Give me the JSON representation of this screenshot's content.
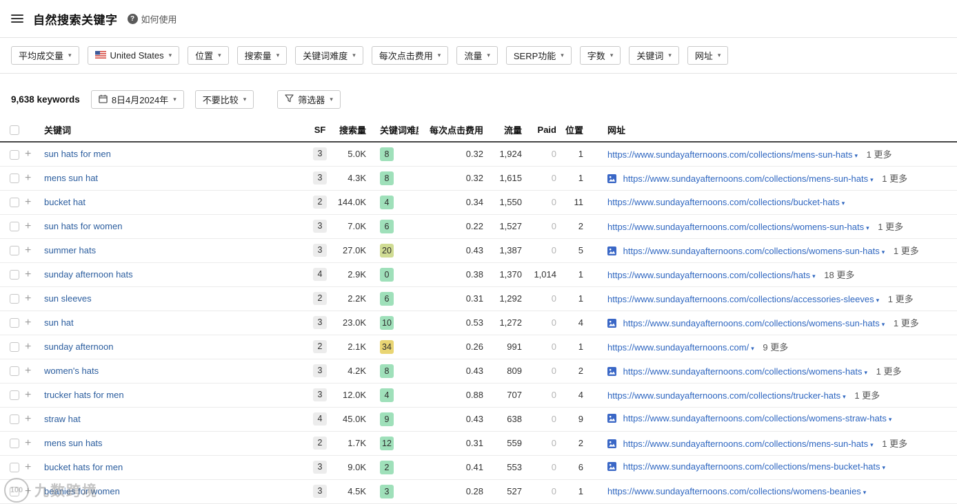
{
  "topbar": {
    "title": "自然搜索关键字",
    "help_label": "如何使用"
  },
  "filterbar": {
    "buttons": [
      {
        "label": "平均成交量",
        "icon": ""
      },
      {
        "label": "United States",
        "icon": "us-flag"
      },
      {
        "label": "位置",
        "icon": ""
      },
      {
        "label": "搜索量",
        "icon": ""
      },
      {
        "label": "关键词难度",
        "icon": ""
      },
      {
        "label": "每次点击费用",
        "icon": ""
      },
      {
        "label": "流量",
        "icon": ""
      },
      {
        "label": "SERP功能",
        "icon": ""
      },
      {
        "label": "字数",
        "icon": ""
      },
      {
        "label": "关键词",
        "icon": ""
      },
      {
        "label": "网址",
        "icon": ""
      }
    ]
  },
  "toolbar": {
    "count": "9,638 keywords",
    "date_label": "8日4月2024年",
    "compare_label": "不要比较",
    "filter_label": "筛选器"
  },
  "table": {
    "headers": {
      "keyword": "关键词",
      "sf": "SF",
      "volume": "搜索量",
      "kd": "关键词难度",
      "cpc": "每次点击费用",
      "traffic": "流量",
      "paid": "Paid",
      "position": "位置",
      "url": "网址"
    },
    "rows": [
      {
        "keyword": "sun hats for men",
        "sf": "3",
        "volume": "5.0K",
        "kd": "8",
        "kd_level": "easy",
        "cpc": "0.32",
        "traffic": "1,924",
        "paid": "0",
        "paid_muted": true,
        "position": "1",
        "thumb": false,
        "url": "https://www.sundayafternoons.com/collections/mens-sun-hats",
        "more": "1 更多"
      },
      {
        "keyword": "mens sun hat",
        "sf": "3",
        "volume": "4.3K",
        "kd": "8",
        "kd_level": "easy",
        "cpc": "0.32",
        "traffic": "1,615",
        "paid": "0",
        "paid_muted": true,
        "position": "1",
        "thumb": true,
        "url": "https://www.sundayafternoons.com/collections/mens-sun-hats",
        "more": "1 更多"
      },
      {
        "keyword": "bucket hat",
        "sf": "2",
        "volume": "144.0K",
        "kd": "4",
        "kd_level": "easy",
        "cpc": "0.34",
        "traffic": "1,550",
        "paid": "0",
        "paid_muted": true,
        "position": "11",
        "thumb": false,
        "url": "https://www.sundayafternoons.com/collections/bucket-hats",
        "more": ""
      },
      {
        "keyword": "sun hats for women",
        "sf": "3",
        "volume": "7.0K",
        "kd": "6",
        "kd_level": "easy",
        "cpc": "0.22",
        "traffic": "1,527",
        "paid": "0",
        "paid_muted": true,
        "position": "2",
        "thumb": false,
        "url": "https://www.sundayafternoons.com/collections/womens-sun-hats",
        "more": "1 更多"
      },
      {
        "keyword": "summer hats",
        "sf": "3",
        "volume": "27.0K",
        "kd": "20",
        "kd_level": "medium",
        "cpc": "0.43",
        "traffic": "1,387",
        "paid": "0",
        "paid_muted": true,
        "position": "5",
        "thumb": true,
        "url": "https://www.sundayafternoons.com/collections/womens-sun-hats",
        "more": "1 更多"
      },
      {
        "keyword": "sunday afternoon hats",
        "sf": "4",
        "volume": "2.9K",
        "kd": "0",
        "kd_level": "easy",
        "cpc": "0.38",
        "traffic": "1,370",
        "paid": "1,014",
        "paid_muted": false,
        "position": "1",
        "thumb": false,
        "url": "https://www.sundayafternoons.com/collections/hats",
        "more": "18 更多"
      },
      {
        "keyword": "sun sleeves",
        "sf": "2",
        "volume": "2.2K",
        "kd": "6",
        "kd_level": "easy",
        "cpc": "0.31",
        "traffic": "1,292",
        "paid": "0",
        "paid_muted": true,
        "position": "1",
        "thumb": false,
        "url": "https://www.sundayafternoons.com/collections/accessories-sleeves",
        "more": "1 更多"
      },
      {
        "keyword": "sun hat",
        "sf": "3",
        "volume": "23.0K",
        "kd": "10",
        "kd_level": "easy",
        "cpc": "0.53",
        "traffic": "1,272",
        "paid": "0",
        "paid_muted": true,
        "position": "4",
        "thumb": true,
        "url": "https://www.sundayafternoons.com/collections/womens-sun-hats",
        "more": "1 更多"
      },
      {
        "keyword": "sunday afternoon",
        "sf": "2",
        "volume": "2.1K",
        "kd": "34",
        "kd_level": "hard",
        "cpc": "0.26",
        "traffic": "991",
        "paid": "0",
        "paid_muted": true,
        "position": "1",
        "thumb": false,
        "url": "https://www.sundayafternoons.com/",
        "more": "9 更多"
      },
      {
        "keyword": "women's hats",
        "sf": "3",
        "volume": "4.2K",
        "kd": "8",
        "kd_level": "easy",
        "cpc": "0.43",
        "traffic": "809",
        "paid": "0",
        "paid_muted": true,
        "position": "2",
        "thumb": true,
        "url": "https://www.sundayafternoons.com/collections/womens-hats",
        "more": "1 更多"
      },
      {
        "keyword": "trucker hats for men",
        "sf": "3",
        "volume": "12.0K",
        "kd": "4",
        "kd_level": "easy",
        "cpc": "0.88",
        "traffic": "707",
        "paid": "0",
        "paid_muted": true,
        "position": "4",
        "thumb": false,
        "url": "https://www.sundayafternoons.com/collections/trucker-hats",
        "more": "1 更多"
      },
      {
        "keyword": "straw hat",
        "sf": "4",
        "volume": "45.0K",
        "kd": "9",
        "kd_level": "easy",
        "cpc": "0.43",
        "traffic": "638",
        "paid": "0",
        "paid_muted": true,
        "position": "9",
        "thumb": true,
        "url": "https://www.sundayafternoons.com/collections/womens-straw-hats",
        "more": ""
      },
      {
        "keyword": "mens sun hats",
        "sf": "2",
        "volume": "1.7K",
        "kd": "12",
        "kd_level": "easy",
        "cpc": "0.31",
        "traffic": "559",
        "paid": "0",
        "paid_muted": true,
        "position": "2",
        "thumb": true,
        "url": "https://www.sundayafternoons.com/collections/mens-sun-hats",
        "more": "1 更多"
      },
      {
        "keyword": "bucket hats for men",
        "sf": "3",
        "volume": "9.0K",
        "kd": "2",
        "kd_level": "easy",
        "cpc": "0.41",
        "traffic": "553",
        "paid": "0",
        "paid_muted": true,
        "position": "6",
        "thumb": true,
        "url": "https://www.sundayafternoons.com/collections/mens-bucket-hats",
        "more": ""
      },
      {
        "keyword": "beanies for women",
        "sf": "3",
        "volume": "4.5K",
        "kd": "3",
        "kd_level": "easy",
        "cpc": "0.28",
        "traffic": "527",
        "paid": "0",
        "paid_muted": true,
        "position": "1",
        "thumb": false,
        "url": "https://www.sundayafternoons.com/collections/womens-beanies",
        "more": ""
      }
    ]
  },
  "watermark": {
    "text": "九数跨境",
    "logo_text": "100"
  },
  "colors": {
    "kd_easy": "#9fe0ba",
    "kd_medium": "#d0dc93",
    "kd_hard": "#e9d573",
    "keyword_link": "#2b5d9e",
    "url_link": "#2e66c0"
  }
}
